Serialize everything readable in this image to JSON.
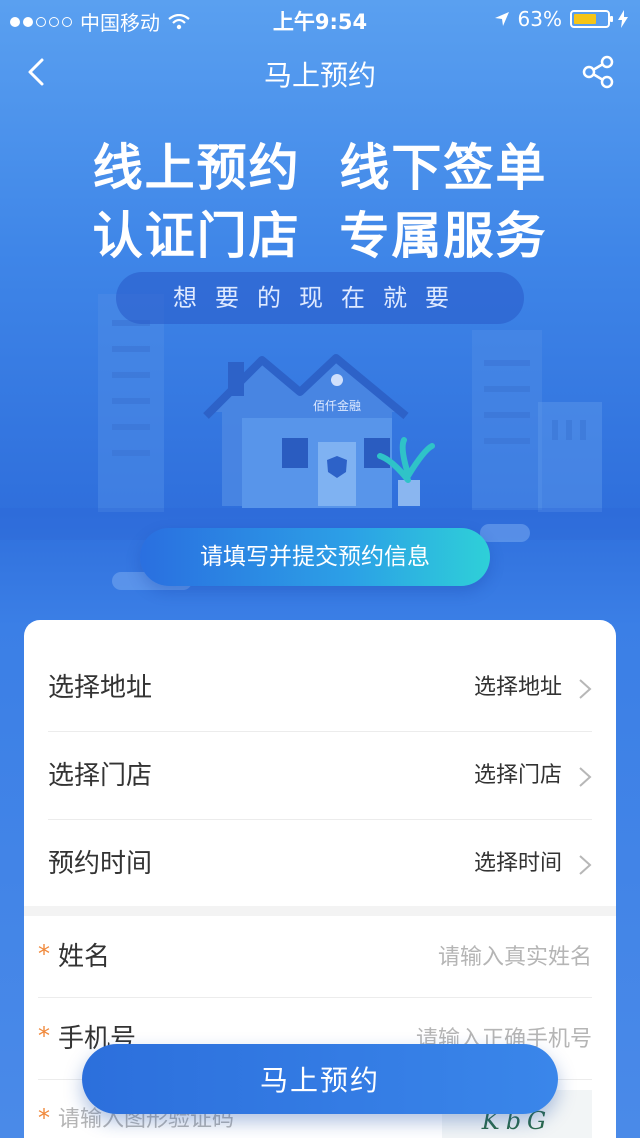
{
  "status_bar": {
    "carrier": "中国移动",
    "time": "上午9:54",
    "battery": "63%",
    "battery_level": 0.63
  },
  "nav": {
    "title": "马上预约",
    "back_icon": "chevron-left-icon",
    "share_icon": "share-icon"
  },
  "hero": {
    "line1": "线上预约  线下签单",
    "line2": "认证门店  专属服务",
    "slogan": "想要的现在就要",
    "brand": "佰仟金融"
  },
  "banner_button": "请填写并提交预约信息",
  "selectors": [
    {
      "label": "选择地址",
      "value": "选择地址"
    },
    {
      "label": "选择门店",
      "value": "选择门店"
    },
    {
      "label": "预约时间",
      "value": "选择时间"
    }
  ],
  "form": {
    "name_label": "姓名",
    "name_placeholder": "请输入真实姓名",
    "phone_label": "手机号",
    "phone_placeholder": "请输入正确手机号",
    "captcha_placeholder": "请输入图形验证码",
    "captcha_text": "KbG",
    "required_mark": "*"
  },
  "submit_button": "马上预约",
  "colors": {
    "accent": "#2f6fdc",
    "required": "#f0883a",
    "battery": "#f5c518"
  }
}
